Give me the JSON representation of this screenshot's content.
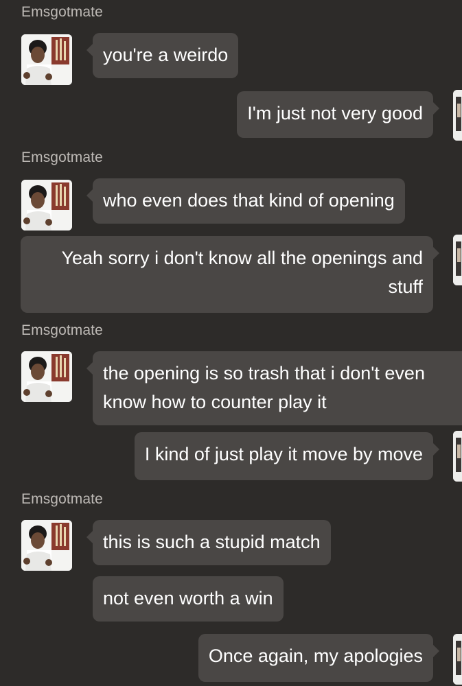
{
  "conversation": {
    "blocks": [
      {
        "sender": "Emsgotmate",
        "messages": [
          {
            "direction": "incoming",
            "text": "you're a weirdo"
          }
        ]
      },
      {
        "sender": null,
        "messages": [
          {
            "direction": "outgoing",
            "text": "I'm just not very good"
          }
        ]
      },
      {
        "sender": "Emsgotmate",
        "messages": [
          {
            "direction": "incoming",
            "text": "who even does that kind of opening"
          }
        ]
      },
      {
        "sender": null,
        "messages": [
          {
            "direction": "outgoing",
            "text": "Yeah sorry i don't know all the openings and stuff"
          }
        ]
      },
      {
        "sender": "Emsgotmate",
        "messages": [
          {
            "direction": "incoming",
            "text": "the opening is so trash that i don't even know how to counter play it"
          }
        ]
      },
      {
        "sender": null,
        "messages": [
          {
            "direction": "outgoing",
            "text": "I kind of just play it move by move"
          }
        ]
      },
      {
        "sender": "Emsgotmate",
        "messages": [
          {
            "direction": "incoming",
            "text": "this is such a stupid match"
          },
          {
            "direction": "incoming",
            "text": "not even worth a win"
          }
        ]
      },
      {
        "sender": null,
        "messages": [
          {
            "direction": "outgoing",
            "text": "Once again, my apologies"
          }
        ]
      }
    ]
  },
  "colors": {
    "background": "#2d2b29",
    "bubble": "#4a4745",
    "sender_text": "#bdb9b5",
    "message_text": "#ffffff"
  },
  "icons": {
    "contact_avatar": "user-photo-avatar",
    "self_avatar": "user-photo-avatar"
  }
}
